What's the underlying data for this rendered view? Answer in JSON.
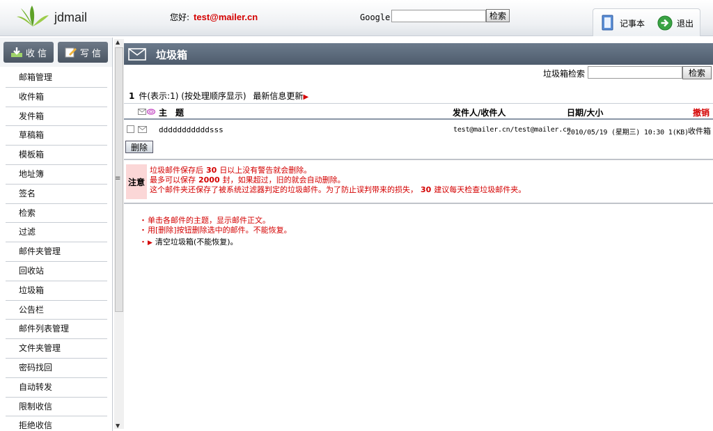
{
  "header": {
    "brand": "jdmail",
    "greeting": "您好:",
    "user_email": "test@mailer.cn",
    "google_label": "Google",
    "google_search_button": "检索",
    "tools": {
      "notepad": "记事本",
      "logout": "退出"
    }
  },
  "sidebar": {
    "receive_button": "收 信",
    "compose_button": "写 信",
    "items": [
      "邮箱管理",
      "收件箱",
      "发件箱",
      "草稿箱",
      "模板箱",
      "地址簿",
      "签名",
      "检索",
      "过滤",
      "邮件夹管理",
      "回收站",
      "垃圾箱",
      "公告栏",
      "邮件列表管理",
      "文件夹管理",
      "密码找回",
      "自动转发",
      "限制收信",
      "拒绝收信"
    ]
  },
  "panel": {
    "title": "垃圾箱",
    "search_label": "垃圾箱检索",
    "search_button": "检索",
    "count_number": "1",
    "count_text": "件(表示:1) (按处理顺序显示)",
    "refresh_link": "最新信息更新"
  },
  "table": {
    "headers": {
      "subject": "主　题",
      "from_to": "发件人/收件人",
      "date_size": "日期/大小",
      "undo": "撤销"
    },
    "rows": [
      {
        "subject": "dddddddddddsss",
        "from_to": "test@mailer.cn/test@mailer.cn",
        "date_size": "2010/05/19 (星期三) 10:30 1(KB)",
        "folder": "收件箱"
      }
    ],
    "delete_button": "删除"
  },
  "notice": {
    "label": "注意",
    "line1_pre": "垃圾邮件保存后",
    "line1_num": "30",
    "line1_post": "日以上没有警告就会删除。",
    "line2_pre": "最多可以保存",
    "line2_num": "2000",
    "line2_post": "封，如果超过，旧的就会自动删除。",
    "line3_pre": "这个邮件夹还保存了被系统过滤器判定的垃圾邮件。为了防止误判带来的损失，",
    "line3_num": "30",
    "line3_post": "建议每天检查垃圾邮件夹。"
  },
  "tips": {
    "bullet": "・",
    "tip1": "单击各邮件的主题，显示邮件正文。",
    "tip2": "用[删除]按钮删除选中的邮件。不能恢复。",
    "empty_trash": "清空垃圾箱(不能恢复)。"
  },
  "colors": {
    "accent_red": "#d40000",
    "panel_header": "#5a6879",
    "notice_bg": "#fbd7d7"
  }
}
